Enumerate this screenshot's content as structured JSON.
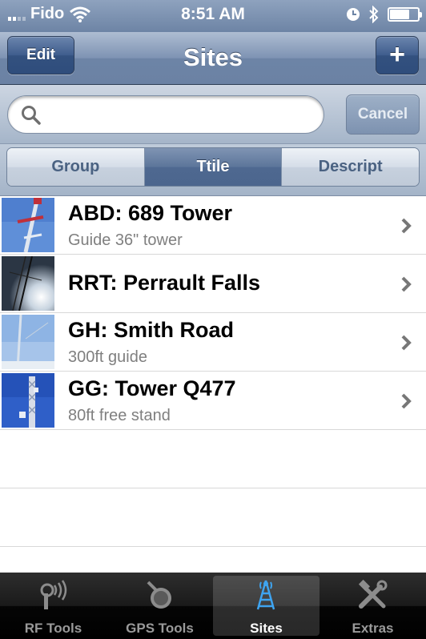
{
  "status_bar": {
    "carrier": "Fido",
    "time": "8:51 AM",
    "icons": [
      "signal-bars-icon",
      "wifi-icon",
      "clock-icon",
      "bluetooth-icon",
      "battery-icon"
    ]
  },
  "nav": {
    "title": "Sites",
    "edit_label": "Edit",
    "add_label": "+"
  },
  "search": {
    "value": "",
    "placeholder": "",
    "cancel_label": "Cancel"
  },
  "sort_segments": [
    {
      "label": "Group",
      "selected": false
    },
    {
      "label": "Ttile",
      "selected": true
    },
    {
      "label": "Descript",
      "selected": false
    }
  ],
  "sites": [
    {
      "title": "ABD: 689 Tower",
      "subtitle": "Guide 36\" tower"
    },
    {
      "title": "RRT: Perrault Falls",
      "subtitle": ""
    },
    {
      "title": "GH: Smith Road",
      "subtitle": "300ft guide"
    },
    {
      "title": "GG: Tower Q477",
      "subtitle": "80ft free stand"
    }
  ],
  "tabs": [
    {
      "label": "RF Tools",
      "icon": "rf-signal-icon",
      "selected": false
    },
    {
      "label": "GPS Tools",
      "icon": "gps-satellite-icon",
      "selected": false
    },
    {
      "label": "Sites",
      "icon": "tower-icon",
      "selected": true
    },
    {
      "label": "Extras",
      "icon": "tools-icon",
      "selected": false
    }
  ],
  "colors": {
    "nav_blue": "#6d84a6",
    "selected_segment": "#5c759a",
    "tab_bar": "#000000"
  }
}
